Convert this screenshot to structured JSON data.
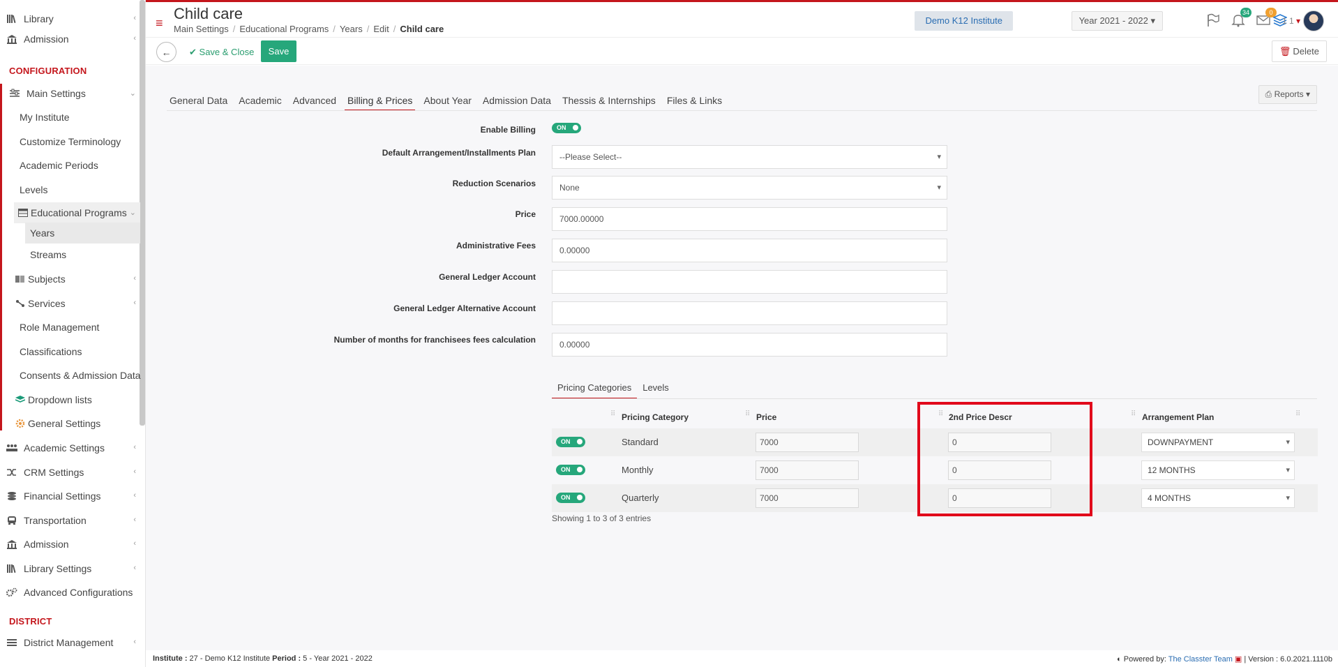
{
  "sidebar": {
    "top_items": [
      {
        "label": "Library",
        "icon": "library-icon"
      },
      {
        "label": "Admission",
        "icon": "institution-icon"
      }
    ],
    "config_heading": "CONFIGURATION",
    "main_settings": {
      "label": "Main Settings",
      "icon": "sliders-icon"
    },
    "main_children": [
      {
        "label": "My Institute"
      },
      {
        "label": "Customize Terminology"
      },
      {
        "label": "Academic Periods"
      },
      {
        "label": "Levels"
      }
    ],
    "educational_programs": {
      "label": "Educational Programs",
      "icon": "table-icon"
    },
    "ep_children": [
      {
        "label": "Years"
      },
      {
        "label": "Streams"
      }
    ],
    "after_children": [
      {
        "label": "Subjects",
        "icon": "book-icon"
      },
      {
        "label": "Services",
        "icon": "share-icon"
      },
      {
        "label": "Role Management"
      },
      {
        "label": "Classifications"
      },
      {
        "label": "Consents & Admission Data"
      },
      {
        "label": "Dropdown lists",
        "icon": "layers-icon"
      },
      {
        "label": "General Settings",
        "icon": "gear-icon"
      }
    ],
    "lower_items": [
      {
        "label": "Academic Settings",
        "icon": "users-icon"
      },
      {
        "label": "CRM Settings",
        "icon": "shuffle-icon"
      },
      {
        "label": "Financial Settings",
        "icon": "coins-icon"
      },
      {
        "label": "Transportation",
        "icon": "bus-icon"
      },
      {
        "label": "Admission",
        "icon": "institution-icon"
      },
      {
        "label": "Library Settings",
        "icon": "library-icon"
      },
      {
        "label": "Advanced Configurations",
        "icon": "gears-icon"
      }
    ],
    "district_heading": "DISTRICT",
    "district_item": {
      "label": "District Management",
      "icon": "list-icon"
    }
  },
  "header": {
    "title": "Child care",
    "breadcrumb": [
      "Main Settings",
      "Educational Programs",
      "Years",
      "Edit",
      "Child care"
    ],
    "institute": "Demo K12 Institute",
    "year": "Year 2021 - 2022",
    "notifications_count": "34",
    "messages_count": "0",
    "user_label": "1 1"
  },
  "toolbar": {
    "save_close": "Save & Close",
    "save": "Save",
    "delete": "Delete"
  },
  "tabs": [
    "General Data",
    "Academic",
    "Advanced",
    "Billing & Prices",
    "About Year",
    "Admission Data",
    "Thessis & Internships",
    "Files & Links"
  ],
  "reports": "Reports",
  "form": {
    "enable_billing": {
      "label": "Enable Billing",
      "value": "ON"
    },
    "default_plan": {
      "label": "Default Arrangement/Installments Plan",
      "value": "--Please Select--"
    },
    "reduction": {
      "label": "Reduction Scenarios",
      "value": "None"
    },
    "price": {
      "label": "Price",
      "value": "7000.00000"
    },
    "admin_fees": {
      "label": "Administrative Fees",
      "value": "0.00000"
    },
    "gl_account": {
      "label": "General Ledger Account",
      "value": ""
    },
    "gl_alt_account": {
      "label": "General Ledger Alternative Account",
      "value": ""
    },
    "months_franchise": {
      "label": "Number of months for franchisees fees calculation",
      "value": "0.00000"
    }
  },
  "subtabs": [
    "Pricing Categories",
    "Levels"
  ],
  "table": {
    "headers": [
      "Pricing Category",
      "Price",
      "2nd Price Descr",
      "Arrangement Plan"
    ],
    "rows": [
      {
        "toggle": "ON",
        "category": "Standard",
        "price": "7000",
        "second": "0",
        "plan": "DOWNPAYMENT"
      },
      {
        "toggle": "ON",
        "category": "Monthly",
        "price": "7000",
        "second": "0",
        "plan": "12 MONTHS"
      },
      {
        "toggle": "ON",
        "category": "Quarterly",
        "price": "7000",
        "second": "0",
        "plan": "4 MONTHS"
      }
    ],
    "info": "Showing 1 to 3 of 3 entries"
  },
  "footer": {
    "institute_label": "Institute :",
    "institute_value": " 27 - Demo K12 Institute ",
    "period_label": "Period :",
    "period_value": " 5 - Year 2021 - 2022",
    "powered": "Powered by:",
    "team": "The Classter Team",
    "version": "| Version : 6.0.2021.1110b"
  },
  "colors": {
    "accent": "#c4161c",
    "primary": "#26a77b",
    "link": "#2a6db2"
  }
}
